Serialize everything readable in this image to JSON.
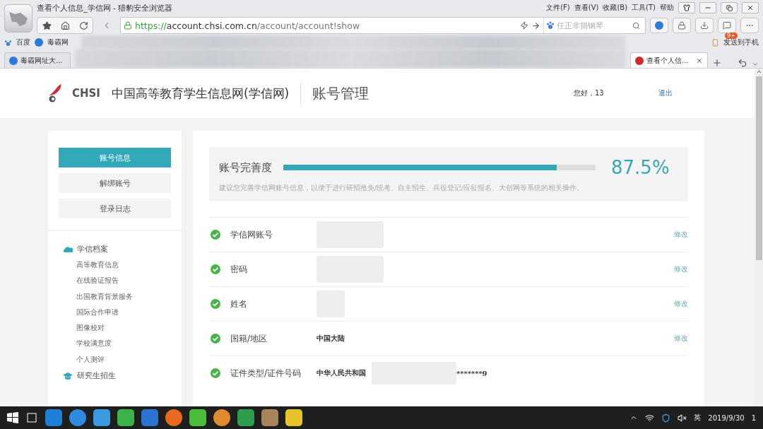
{
  "browser": {
    "title": "查看个人信息_学信网 - 猎豹安全浏览器",
    "menu": [
      "文件(F)",
      "查看(V)",
      "收藏(B)",
      "工具(T)",
      "帮助"
    ],
    "url": {
      "scheme": "https://",
      "host": "account.chsi.com.cn",
      "path": "/account/account!show"
    },
    "search_placeholder": "任正非捐钢琴",
    "badge": "9+",
    "bookmarks": [
      "百度",
      "毒霸网"
    ],
    "send_to_phone": "发送到手机",
    "tabs": [
      {
        "label": "毒霸网址大...",
        "selected": false
      },
      {
        "label": "查看个人信...",
        "selected": true
      }
    ]
  },
  "header": {
    "logo_text": "CHSI",
    "site_name": "中国高等教育学生信息网(学信网)",
    "section": "账号管理",
    "greeting": "您好，13",
    "logout": "退出"
  },
  "sidebar": {
    "buttons": [
      {
        "label": "账号信息",
        "selected": true
      },
      {
        "label": "解绑账号",
        "selected": false
      },
      {
        "label": "登录日志",
        "selected": false
      }
    ],
    "groups": [
      {
        "title": "学信档案",
        "kind": "cloud",
        "items": [
          "高等教育信息",
          "在线验证报告",
          "出国教育背景服务",
          "国际合作申请",
          "图像校对",
          "学校满意度",
          "个人测评"
        ]
      },
      {
        "title": "研究生招生",
        "kind": "cap"
      }
    ]
  },
  "completeness": {
    "title": "账号完善度",
    "level": 0.875,
    "percent": "87.5%",
    "hint": "建议您完善学信网账号信息，以便于进行研招推免/统考、自主招生、兵役登记/应征报名、大创网等系统的相关操作。"
  },
  "fields": [
    {
      "label": "学信网账号",
      "action": "修改",
      "verified": true
    },
    {
      "label": "密码",
      "action": "修改",
      "verified": true
    },
    {
      "label": "姓名",
      "action": "修改",
      "verified": true
    },
    {
      "label": "国籍/地区",
      "value": "中国大陆",
      "action": "修改",
      "verified": true
    },
    {
      "label": "证件类型/证件号码",
      "value": "中华人民共和国",
      "value_tail": "*******9",
      "verified": true
    }
  ],
  "taskbar": {
    "ime": "英",
    "date": "2019/9/30",
    "notifications": "1"
  }
}
